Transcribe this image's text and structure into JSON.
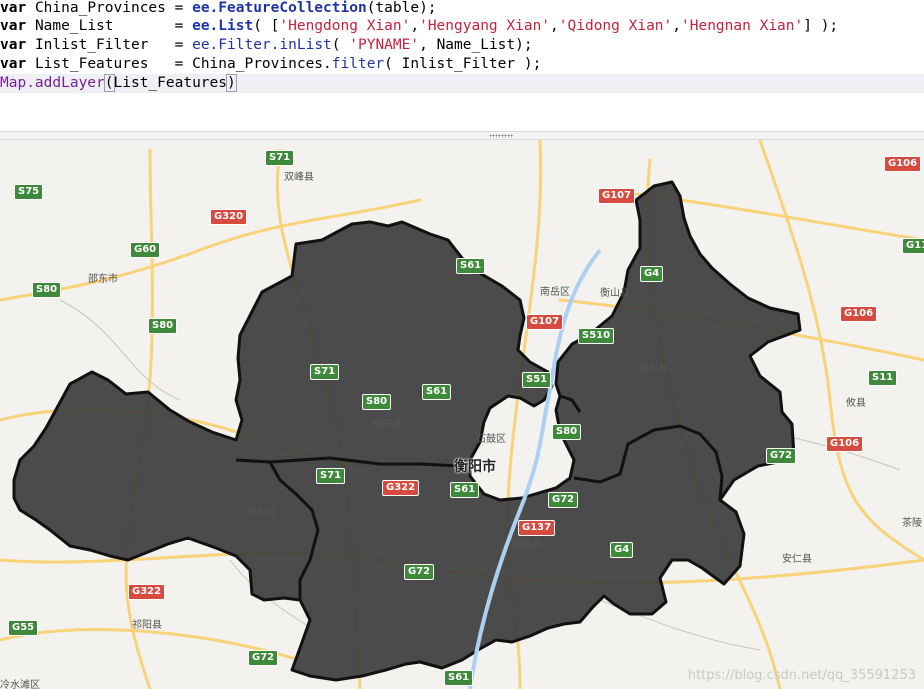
{
  "code": {
    "line1": {
      "kw": "var",
      "name": "China_Provinces",
      "eq": " = ",
      "cls": "ee.FeatureCollection",
      "rest": "(table);"
    },
    "line2": {
      "kw": "var",
      "name": "Name_List",
      "pad": "       = ",
      "cls": "ee.List",
      "open": "( [",
      "s1": "'Hengdong Xian'",
      "s2": "'Hengyang Xian'",
      "s3": "'Qidong Xian'",
      "s4": "'Hengnan Xian'",
      "close": "] );"
    },
    "line3": {
      "kw": "var",
      "name": "Inlist_Filter",
      "pad": "   = ",
      "obj": "ee.",
      "mth": "Filter.inList",
      "open": "( ",
      "arg": "'PYNAME'",
      "rest": ", Name_List);"
    },
    "line4": {
      "kw": "var",
      "name": "List_Features",
      "pad": "   = ",
      "obj": "China_Provinces.",
      "mth": "filter",
      "rest": "( Inlist_Filter );"
    },
    "line5": {
      "obj": "Map.addLayer",
      "rest": "List_Features"
    }
  },
  "map": {
    "city": "衡阳市",
    "places": [
      "双峰县",
      "邵东市",
      "南岳区",
      "衡山县",
      "衡东县",
      "攸县",
      "衡阳县",
      "石鼓区",
      "祁东县",
      "衡南县",
      "安仁县",
      "茶陵",
      "祁阳县",
      "冷水滩区"
    ],
    "shields": [
      "S71",
      "S75",
      "G107",
      "G106",
      "G320",
      "G60",
      "S61",
      "G11",
      "S80",
      "S80",
      "G4",
      "G107",
      "S510",
      "G106",
      "S71",
      "S51",
      "S11",
      "S80",
      "S61",
      "衡东县",
      "S80",
      "G106",
      "G72",
      "S71",
      "G322",
      "S61",
      "G72",
      "G137",
      "G4",
      "G322",
      "G72",
      "G55",
      "G72",
      "S61"
    ],
    "watermark": "https://blog.csdn.net/qq_35591253"
  },
  "colors": {
    "region_fill": "#3d3d3d",
    "region_stroke": "#111111",
    "highway_green": "#3e8a3a",
    "highway_red": "#d64b3f",
    "road_yellow": "#f8d37a"
  }
}
